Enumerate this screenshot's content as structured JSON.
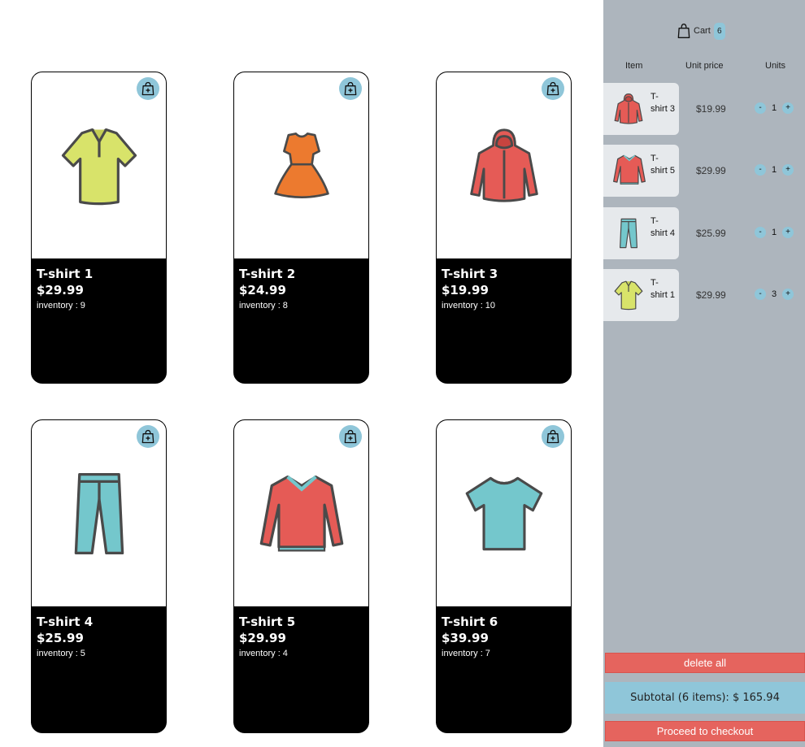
{
  "products": [
    {
      "name": "T-shirt 1",
      "price": "$29.99",
      "inventory": "inventory : 9",
      "icon": "polo-shirt-icon",
      "add_icon": "add-to-bag-icon"
    },
    {
      "name": "T-shirt 2",
      "price": "$24.99",
      "inventory": "inventory : 8",
      "icon": "dress-icon",
      "add_icon": "add-to-bag-icon"
    },
    {
      "name": "T-shirt 3",
      "price": "$19.99",
      "inventory": "inventory : 10",
      "icon": "hoodie-icon",
      "add_icon": "add-to-bag-icon"
    },
    {
      "name": "T-shirt 4",
      "price": "$25.99",
      "inventory": "inventory : 5",
      "icon": "jeans-icon",
      "add_icon": "add-to-bag-icon"
    },
    {
      "name": "T-shirt 5",
      "price": "$29.99",
      "inventory": "inventory : 4",
      "icon": "sweater-icon",
      "add_icon": "add-to-bag-icon"
    },
    {
      "name": "T-shirt 6",
      "price": "$39.99",
      "inventory": "inventory : 7",
      "icon": "tshirt-icon",
      "add_icon": "add-to-bag-icon"
    }
  ],
  "cart": {
    "label": "Cart",
    "count": "6",
    "icon": "shopping-bag-icon",
    "columns": {
      "item": "Item",
      "unit_price": "Unit price",
      "units": "Units"
    },
    "items": [
      {
        "title": "T-shirt 3",
        "unit_price": "$19.99",
        "units": "1",
        "icon": "hoodie-icon"
      },
      {
        "title": "T-shirt 5",
        "unit_price": "$29.99",
        "units": "1",
        "icon": "sweater-icon"
      },
      {
        "title": "T-shirt 4",
        "unit_price": "$25.99",
        "units": "1",
        "icon": "jeans-icon"
      },
      {
        "title": "T-shirt 1",
        "unit_price": "$29.99",
        "units": "3",
        "icon": "polo-shirt-icon"
      }
    ],
    "minus_label": "-",
    "plus_label": "+",
    "delete_all": "delete all",
    "subtotal": "Subtotal (6 items): $ 165.94",
    "checkout": "Proceed to checkout"
  },
  "colors": {
    "sidebar": "#adb5bd",
    "accent_blue": "#8fc6d9",
    "accent_red": "#e5645e",
    "card_info_bg": "#000000"
  }
}
